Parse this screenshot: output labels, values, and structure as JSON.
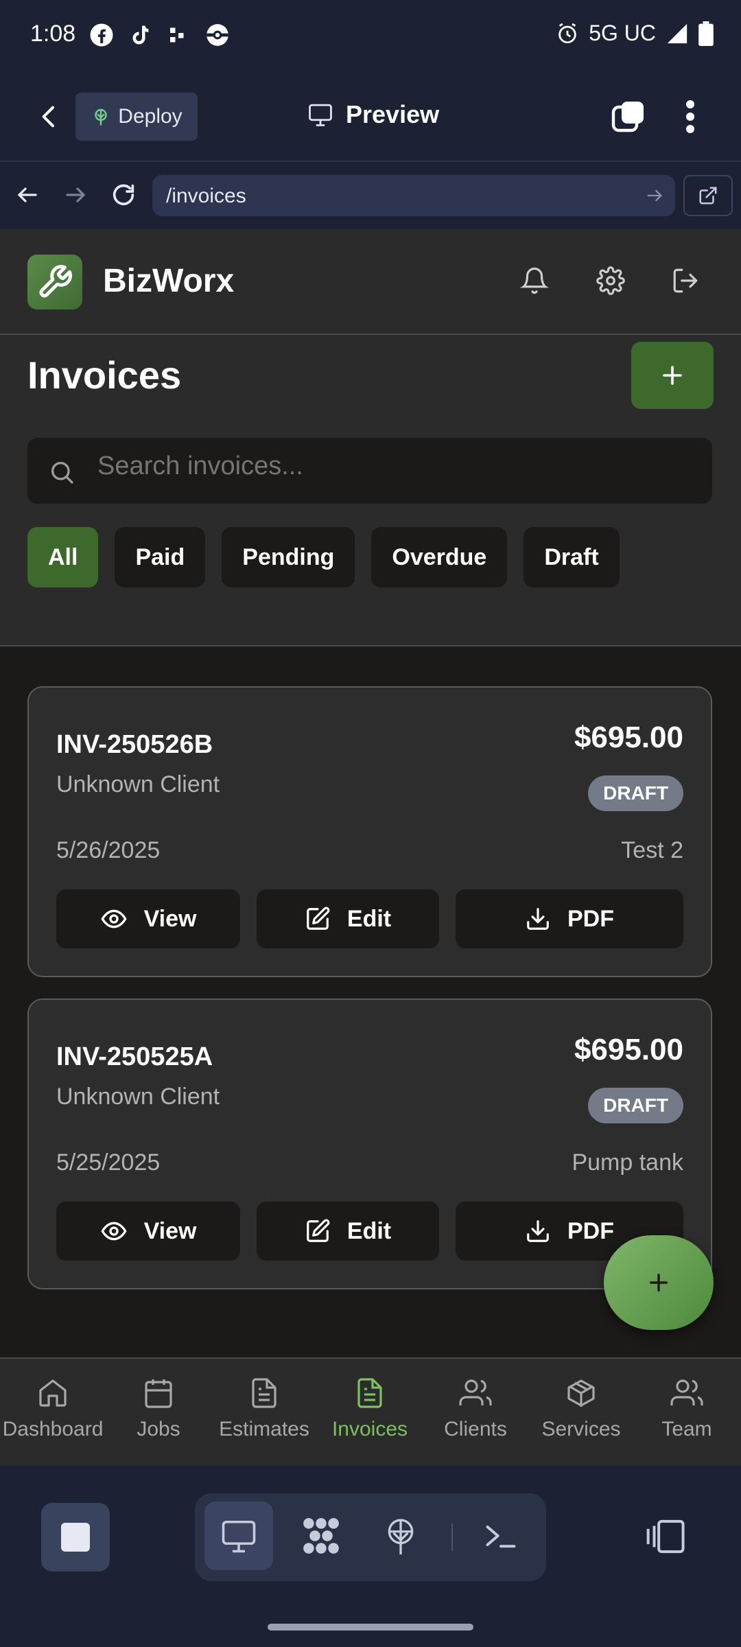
{
  "status_bar": {
    "time": "1:08",
    "network": "5G UC"
  },
  "top_bar": {
    "deploy_label": "Deploy",
    "preview_label": "Preview"
  },
  "url_bar": {
    "url": "/invoices"
  },
  "app": {
    "brand": "BizWorx",
    "page_title": "Invoices",
    "search_placeholder": "Search invoices...",
    "filters": [
      "All",
      "Paid",
      "Pending",
      "Overdue",
      "Draft"
    ],
    "active_filter": "All",
    "invoices": [
      {
        "number": "INV-250526B",
        "client": "Unknown Client",
        "amount": "$695.00",
        "status": "DRAFT",
        "date": "5/26/2025",
        "note": "Test 2"
      },
      {
        "number": "INV-250525A",
        "client": "Unknown Client",
        "amount": "$695.00",
        "status": "DRAFT",
        "date": "5/25/2025",
        "note": "Pump tank"
      }
    ],
    "actions": {
      "view": "View",
      "edit": "Edit",
      "pdf": "PDF"
    },
    "nav": [
      "Dashboard",
      "Jobs",
      "Estimates",
      "Invoices",
      "Clients",
      "Services",
      "Team"
    ],
    "active_nav": "Invoices"
  },
  "colors": {
    "accent": "#3d6a2c",
    "accent_light": "#7fbf5e",
    "badge": "#747a88",
    "system_bg": "#1c2234"
  }
}
